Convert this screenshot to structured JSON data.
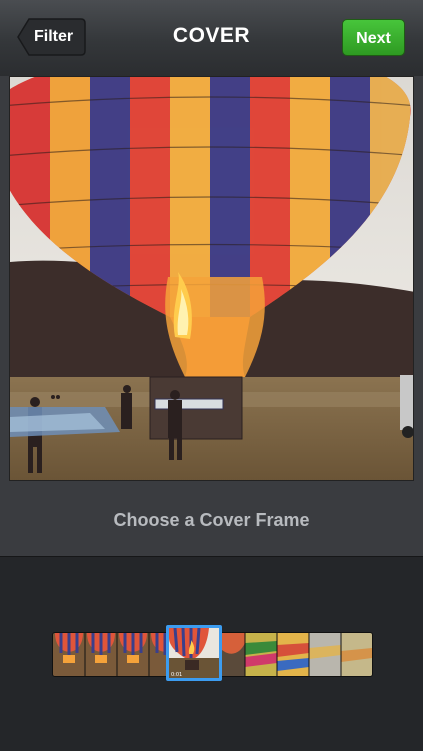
{
  "header": {
    "title": "COVER",
    "back_label": "Filter",
    "next_label": "Next"
  },
  "preview": {
    "caption": "Choose a Cover Frame",
    "image": "hot-air-balloon-photo"
  },
  "filmstrip": {
    "frame_count": 10,
    "selected_index": 3
  },
  "colors": {
    "next_button": "#37ad2a",
    "selection_border": "#3c9cf0",
    "background": "#232528"
  }
}
